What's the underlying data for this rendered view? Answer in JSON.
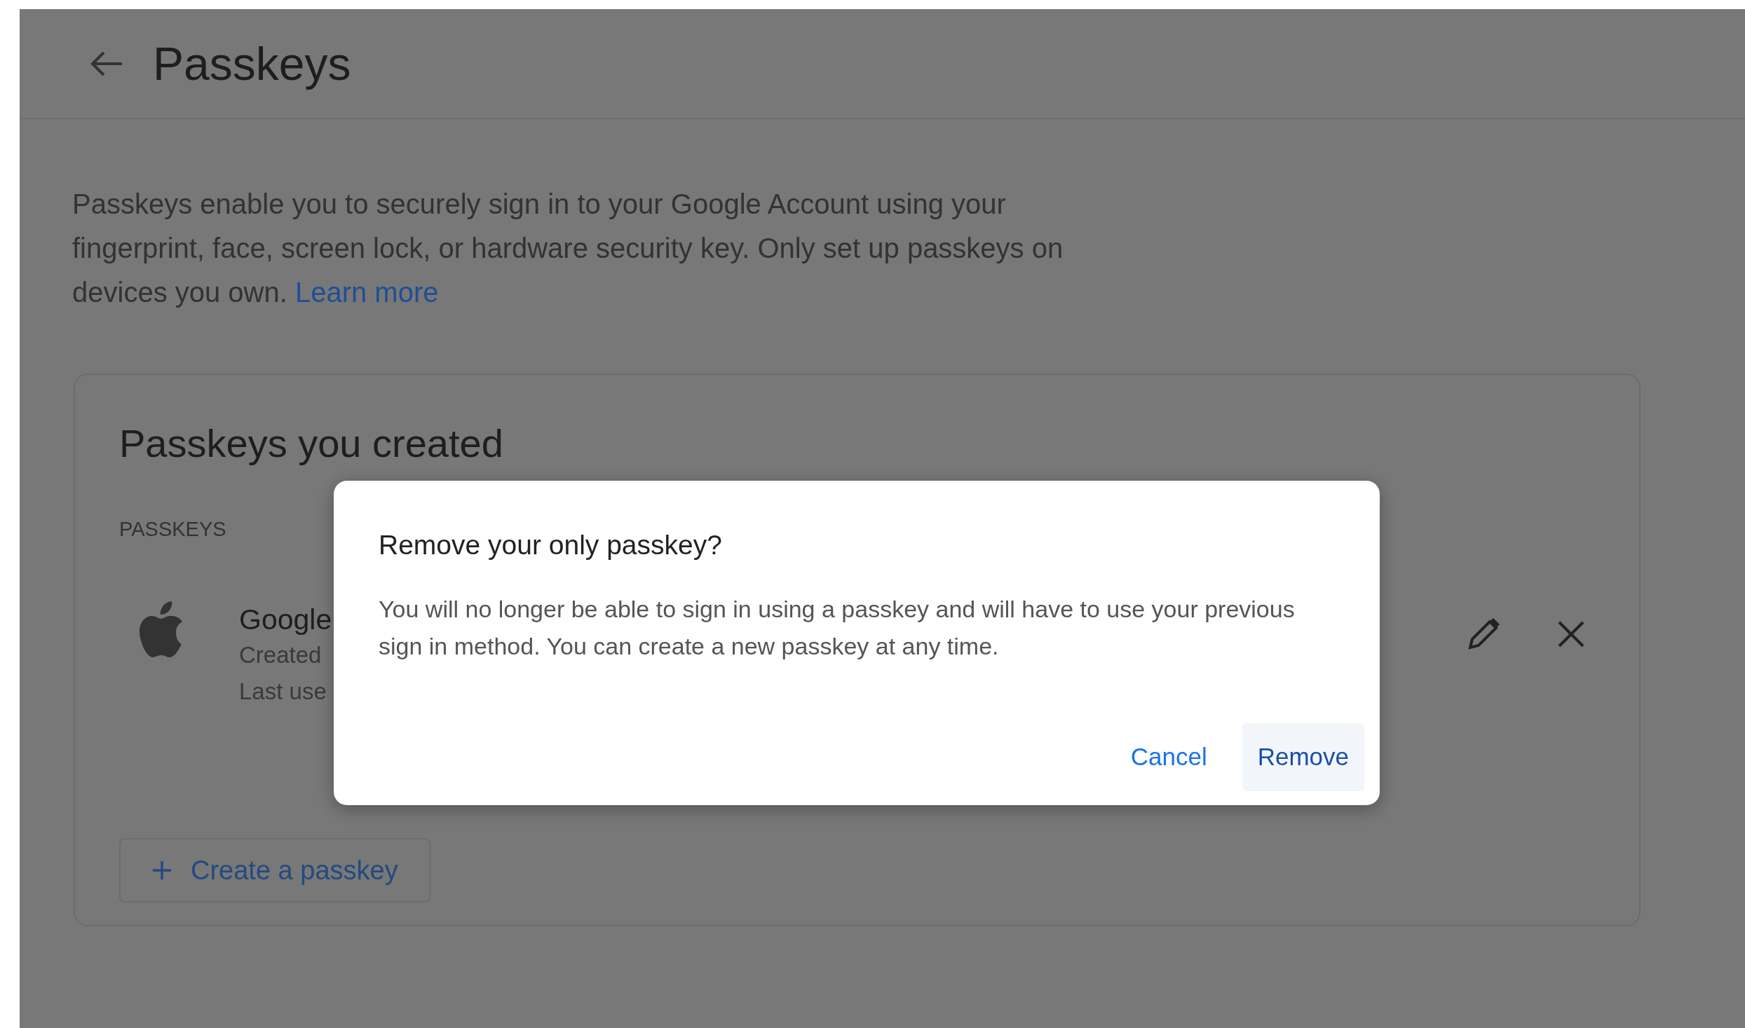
{
  "header": {
    "title": "Passkeys"
  },
  "intro": {
    "text": "Passkeys enable you to securely sign in to your Google Account using your fingerprint, face, screen lock, or hardware security key. Only set up passkeys on devices you own.",
    "link": "Learn more"
  },
  "card": {
    "title": "Passkeys you created",
    "section_label": "PASSKEYS",
    "passkeys": [
      {
        "name": "Google",
        "created": "Created",
        "last_used": "Last use"
      }
    ],
    "create_button": {
      "label": "Create a passkey"
    }
  },
  "dialog": {
    "title": "Remove your only passkey?",
    "body": "You will no longer be able to sign in using a passkey and will have to use your previous sign in method. You can create a new passkey at any time.",
    "buttons": [
      {
        "label": "Cancel",
        "focused": false
      },
      {
        "label": "Remove",
        "focused": true
      }
    ]
  }
}
